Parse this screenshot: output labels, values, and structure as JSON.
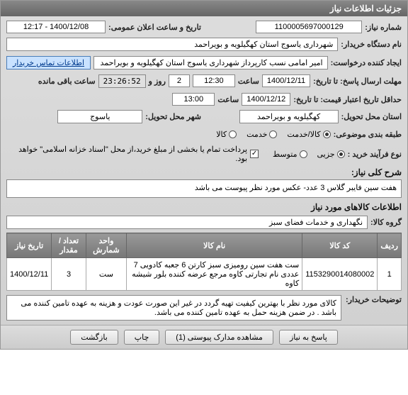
{
  "header": {
    "title": "جزئیات اطلاعات نیاز"
  },
  "fields": {
    "need_no_label": "شماره نیاز:",
    "need_no": "1100005697000129",
    "announce_label": "تاریخ و ساعت اعلان عمومی:",
    "announce": "1400/12/08 - 12:17",
    "buyer_org_label": "نام دستگاه خریدار:",
    "buyer_org": "شهرداری یاسوج استان کهگیلویه و بویراحمد",
    "requester_label": "ایجاد کننده درخواست:",
    "requester": "امیر امامی نسب کارپرداز شهرداری یاسوج استان کهگیلویه و بویراحمد",
    "contact_link": "اطلاعات تماس خریدار",
    "deadline_label": "مهلت ارسال پاسخ: تا تاریخ:",
    "deadline_date": "1400/12/11",
    "time_label": "ساعت",
    "deadline_time": "12:30",
    "days": "2",
    "day_label": "روز و",
    "countdown": "23:26:52",
    "remain_label": "ساعت باقی مانده",
    "validity_label": "حداقل تاریخ اعتبار قیمت: تا تاریخ:",
    "validity_date": "1400/12/12",
    "validity_time": "13:00",
    "province_label": "استان محل تحویل:",
    "province": "کهگیلویه و بویراحمد",
    "city_label": "شهر محل تحویل:",
    "city": "یاسوج",
    "classify_label": "طبقه بندی موضوعی:",
    "opt_goods": "کالا",
    "opt_service": "خدمت",
    "opt_both": "کالا/خدمت",
    "process_label": "نوع فرآیند خرید :",
    "opt_partial": "جزیی",
    "opt_medium": "متوسط",
    "payment_note": "پرداخت تمام یا بخشی از مبلغ خرید،از محل \"اسناد خزانه اسلامی\" خواهد بود."
  },
  "summary": {
    "label": "شرح کلی نیاز:",
    "text": "هفت سین فایبر گلاس 3 عدد- عکس مورد نظر پیوست می باشد"
  },
  "items_section": {
    "title": "اطلاعات کالاهای مورد نیاز",
    "group_label": "گروه کالا:",
    "group": "نگهداری و خدمات فضای سبز"
  },
  "table": {
    "headers": {
      "row": "ردیف",
      "code": "کد کالا",
      "name": "نام کالا",
      "unit": "واحد شمارش",
      "qty": "تعداد / مقدار",
      "date": "تاریخ نیاز"
    },
    "rows": [
      {
        "row": "1",
        "code": "1153290014080002",
        "name": "ست هفت سین رومیزی سبز کارتن 6 جعبه کادویی 7 عددی نام تجارتی کاوه مرجع عرضه کننده بلور شیشه کاوه",
        "unit": "ست",
        "qty": "3",
        "date": "1400/12/11"
      }
    ]
  },
  "buyer_notes": {
    "label": "توضیحات خریدار:",
    "text": "کالای مورد نظر با بهترین کیفیت تهیه گردد  در غیر این صورت عودت و هزینه به عهده تامین کننده می باشد . در ضمن هزینه حمل به عهده تامین کننده می باشد."
  },
  "buttons": {
    "reply": "پاسخ به نیاز",
    "attachments": "مشاهده مدارک پیوستی (1)",
    "print": "چاپ",
    "back": "بازگشت"
  }
}
